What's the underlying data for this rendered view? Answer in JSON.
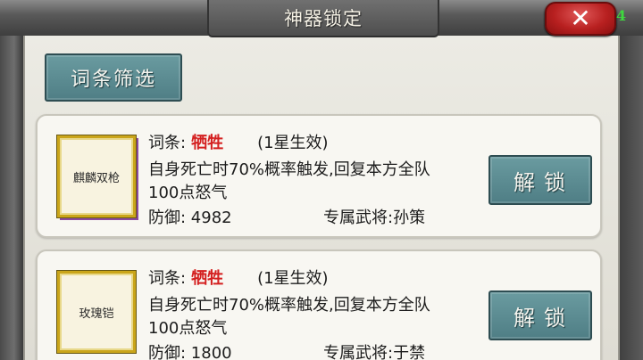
{
  "header": {
    "title": "神器锁定",
    "close_icon": "close-x-icon",
    "corner_number": "4"
  },
  "filter_button": {
    "label": "词条筛选"
  },
  "artifacts": [
    {
      "name": "麒麟双枪",
      "entry_label": "词条:",
      "entry_name": "牺牲",
      "entry_star": "(1星生效)",
      "description_line1": "自身死亡时70%概率触发,回复本方全队",
      "description_line2": "100点怒气",
      "defense": "防御: 4982",
      "exclusive_general": "专属武将:孙策",
      "unlock_label": "解锁"
    },
    {
      "name": "玫瑰铠",
      "entry_label": "词条:",
      "entry_name": "牺牲",
      "entry_star": "(1星生效)",
      "description_line1": "自身死亡时70%概率触发,回复本方全队",
      "description_line2": "100点怒气",
      "defense": "防御: 1800",
      "exclusive_general": "专属武将:于禁",
      "unlock_label": "解锁"
    }
  ],
  "colors": {
    "accent_teal": "#5a8a90",
    "entry_red": "#d42020",
    "close_red": "#c62a2a",
    "frame_gold": "#caa51a"
  }
}
